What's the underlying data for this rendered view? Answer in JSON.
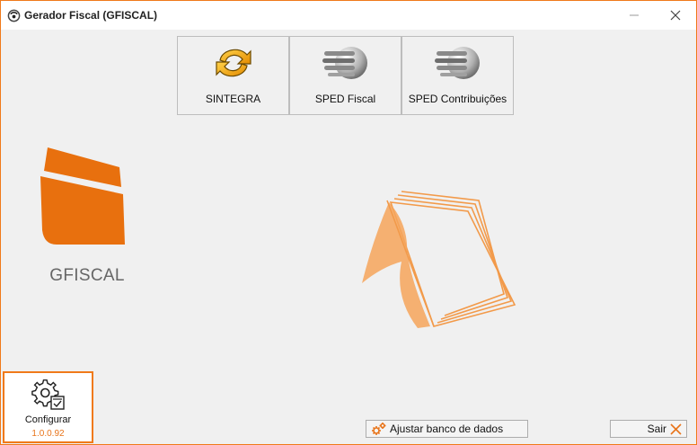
{
  "window": {
    "title": "Gerador Fiscal (GFISCAL)",
    "icons": {
      "app": "app-logo-icon",
      "minimize": "minimize-icon",
      "close": "close-icon"
    }
  },
  "toolbar": {
    "items": [
      {
        "label": "SINTEGRA",
        "icon": "sintegra-refresh-icon"
      },
      {
        "label": "SPED Fiscal",
        "icon": "sped-stack-icon"
      },
      {
        "label": "SPED Contribuições",
        "icon": "sped-stack-icon"
      }
    ]
  },
  "brand": {
    "name": "GFISCAL",
    "color": "#e8700e"
  },
  "config": {
    "label": "Configurar",
    "version": "1.0.0.92",
    "icon": "gear-settings-icon"
  },
  "footer": {
    "db_label": "Ajustar banco de dados",
    "db_icon": "gears-icon",
    "exit_label": "Sair",
    "exit_icon": "close-x-icon"
  },
  "colors": {
    "accent": "#f07a1a",
    "background": "#f0f0f0"
  }
}
